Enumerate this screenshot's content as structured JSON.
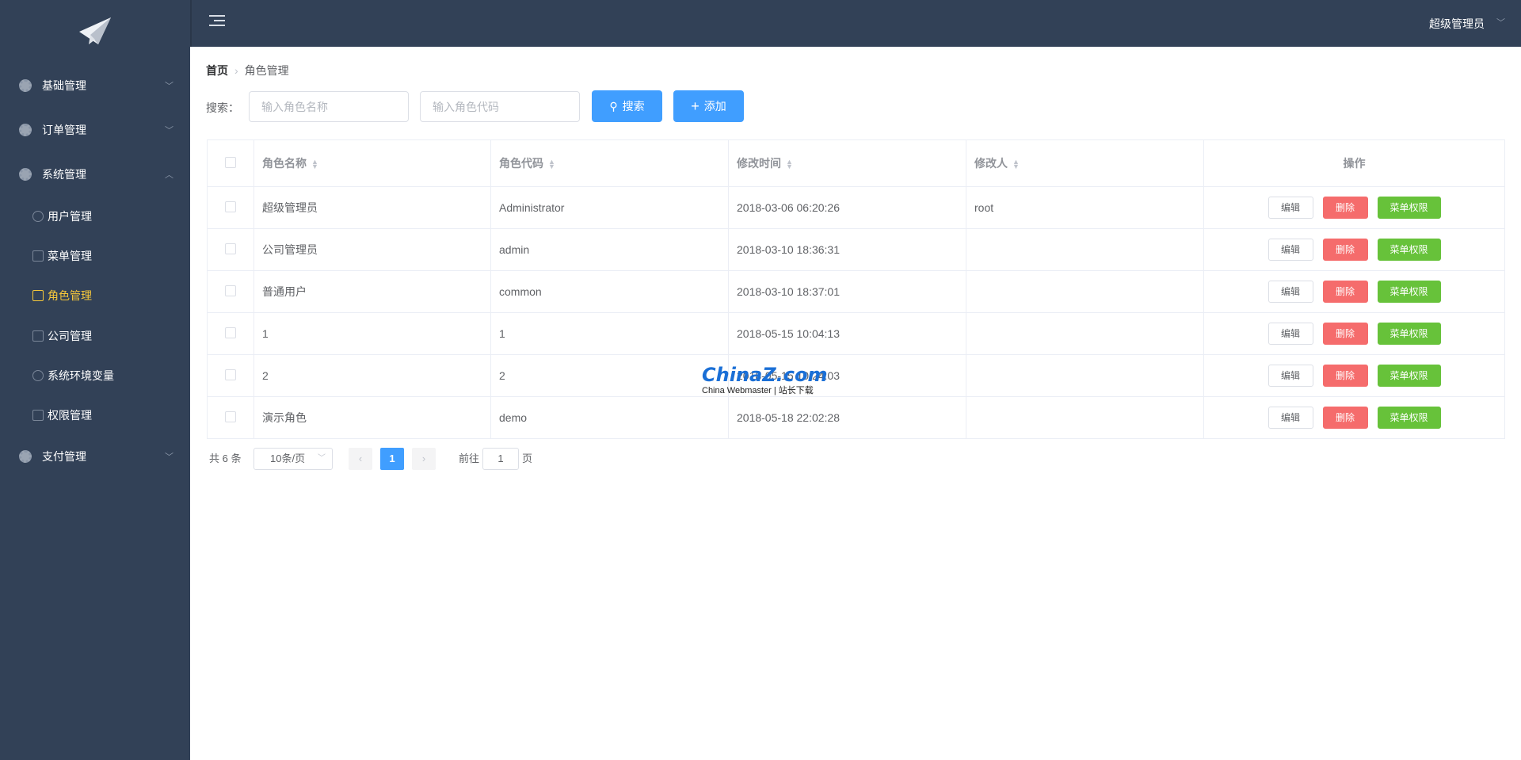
{
  "sidebar": {
    "items": [
      {
        "label": "基础管理",
        "expanded": false
      },
      {
        "label": "订单管理",
        "expanded": false
      },
      {
        "label": "系统管理",
        "expanded": true,
        "children": [
          {
            "label": "用户管理",
            "icon": "users-icon"
          },
          {
            "label": "菜单管理",
            "icon": "doc-settings-icon"
          },
          {
            "label": "角色管理",
            "icon": "role-icon",
            "active": true
          },
          {
            "label": "公司管理",
            "icon": "building-icon"
          },
          {
            "label": "系统环境变量",
            "icon": "cloud-settings-icon"
          },
          {
            "label": "权限管理",
            "icon": "doc-settings-icon"
          }
        ]
      },
      {
        "label": "支付管理",
        "expanded": false
      }
    ]
  },
  "header": {
    "user": "超级管理员"
  },
  "breadcrumb": {
    "home": "首页",
    "current": "角色管理"
  },
  "search": {
    "label": "搜索：",
    "name_placeholder": "输入角色名称",
    "code_placeholder": "输入角色代码",
    "search_button": "搜索",
    "add_button": "添加"
  },
  "table": {
    "columns": [
      "角色名称",
      "角色代码",
      "修改时间",
      "修改人",
      "操作"
    ],
    "rows": [
      {
        "name": "超级管理员",
        "code": "Administrator",
        "time": "2018-03-06 06:20:26",
        "modifier": "root"
      },
      {
        "name": "公司管理员",
        "code": "admin",
        "time": "2018-03-10 18:36:31",
        "modifier": ""
      },
      {
        "name": "普通用户",
        "code": "common",
        "time": "2018-03-10 18:37:01",
        "modifier": ""
      },
      {
        "name": "1",
        "code": "1",
        "time": "2018-05-15 10:04:13",
        "modifier": ""
      },
      {
        "name": "2",
        "code": "2",
        "time": "2018-05-15 10:24:03",
        "modifier": ""
      },
      {
        "name": "演示角色",
        "code": "demo",
        "time": "2018-05-18 22:02:28",
        "modifier": ""
      }
    ],
    "actions": {
      "edit": "编辑",
      "delete": "删除",
      "perm": "菜单权限"
    }
  },
  "pagination": {
    "total": "共 6 条",
    "page_size": "10条/页",
    "current": "1",
    "goto": "前往",
    "goto_value": "1",
    "page_suffix": "页"
  },
  "watermark": {
    "title": "ChinaZ.com",
    "subtitle": "China Webmaster | 站长下载"
  },
  "colors": {
    "sidebar": "#324157",
    "primary": "#409eff",
    "danger": "#f56c6c",
    "success": "#67c23a",
    "active": "#f5c73b"
  }
}
